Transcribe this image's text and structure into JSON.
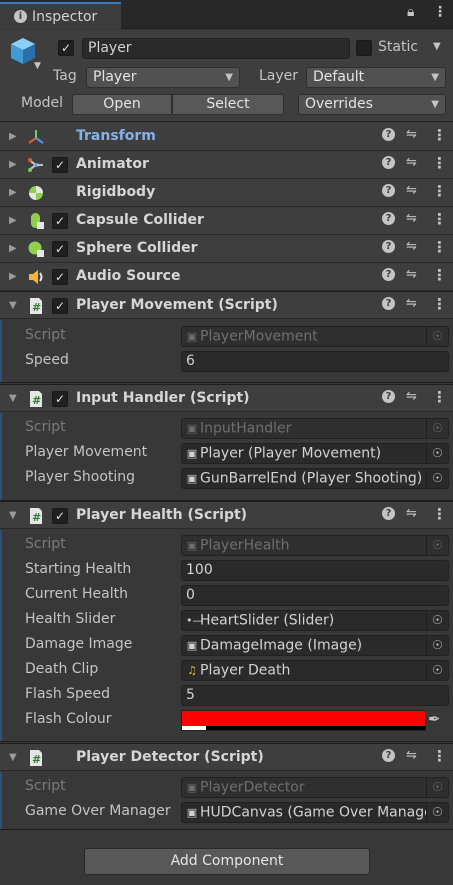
{
  "tab": {
    "title": "Inspector",
    "icon": "info-icon"
  },
  "gameobject": {
    "name": "Player",
    "active": true,
    "static_label": "Static",
    "static_checked": false,
    "tag_label": "Tag",
    "tag_value": "Player",
    "layer_label": "Layer",
    "layer_value": "Default",
    "model_label": "Model",
    "open_label": "Open",
    "select_label": "Select",
    "overrides_label": "Overrides"
  },
  "components": {
    "transform": {
      "name": "Transform"
    },
    "animator": {
      "name": "Animator"
    },
    "rigidbody": {
      "name": "Rigidbody"
    },
    "capsule": {
      "name": "Capsule Collider"
    },
    "sphere": {
      "name": "Sphere Collider"
    },
    "audio": {
      "name": "Audio Source"
    },
    "movement": {
      "name": "Player Movement (Script)",
      "script_label": "Script",
      "script_value": "PlayerMovement",
      "speed_label": "Speed",
      "speed_value": "6"
    },
    "input": {
      "name": "Input Handler (Script)",
      "script_label": "Script",
      "script_value": "InputHandler",
      "movement_label": "Player Movement",
      "movement_value": "Player (Player Movement)",
      "shooting_label": "Player Shooting",
      "shooting_value": "GunBarrelEnd (Player Shooting)"
    },
    "health": {
      "name": "Player Health (Script)",
      "script_label": "Script",
      "script_value": "PlayerHealth",
      "starting_label": "Starting Health",
      "starting_value": "100",
      "current_label": "Current Health",
      "current_value": "0",
      "slider_label": "Health Slider",
      "slider_value": "HeartSlider (Slider)",
      "damage_label": "Damage Image",
      "damage_value": "DamageImage (Image)",
      "clip_label": "Death Clip",
      "clip_value": "Player Death",
      "flashspeed_label": "Flash Speed",
      "flashspeed_value": "5",
      "flashcolour_label": "Flash Colour",
      "flashcolour_value": "#ff0000"
    },
    "detector": {
      "name": "Player Detector (Script)",
      "script_label": "Script",
      "script_value": "PlayerDetector",
      "gom_label": "Game Over Manager",
      "gom_value": "HUDCanvas (Game Over Manager)"
    }
  },
  "add_component_label": "Add Component",
  "colors": {
    "accent": "#3a79bb",
    "link": "#86b1e8",
    "flash_colour": "#ff0000"
  }
}
